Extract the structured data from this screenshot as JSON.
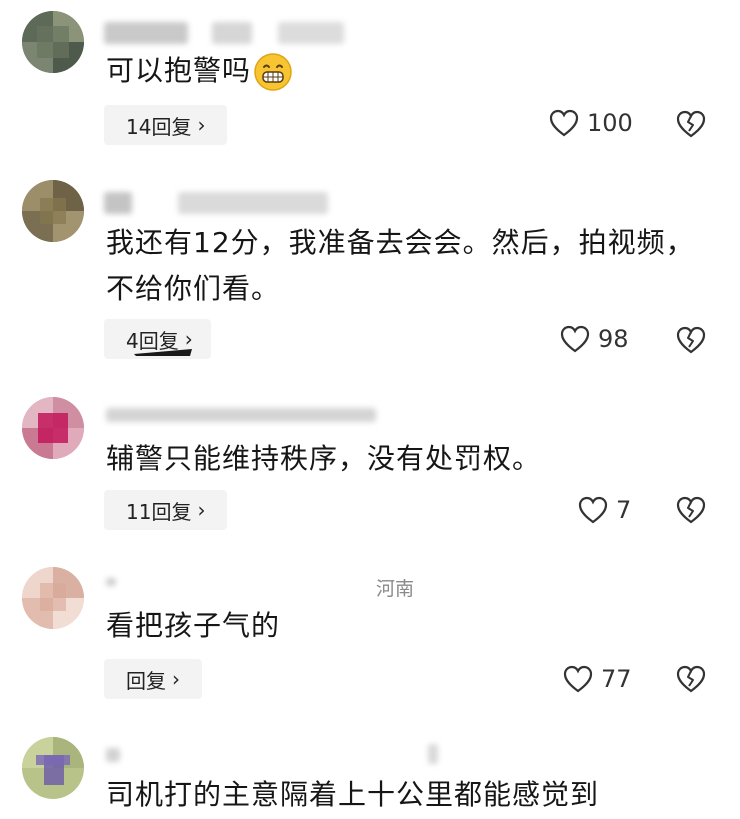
{
  "comments": [
    {
      "text": "可以抱警吗",
      "emoji": "grinning-face-emoji",
      "reply_label": "14回复",
      "likes": "100",
      "location": ""
    },
    {
      "text_line1": "我还有12分，我准备去会会。然后，拍视频，",
      "text_line2": "不给你们看。",
      "reply_label": "4回复",
      "likes": "98",
      "location": ""
    },
    {
      "text": "辅警只能维持秩序，没有处罚权。",
      "reply_label": "11回复",
      "likes": "7",
      "location": ""
    },
    {
      "text": "看把孩子气的",
      "reply_label": "回复",
      "likes": "77",
      "location": "河南"
    },
    {
      "text": "司机打的主意隔着上十公里都能感觉到",
      "location": ""
    }
  ],
  "colors": {
    "text": "#161616",
    "reply_bg": "#f3f3f3",
    "meta": "#8a8a8a"
  },
  "icons": {
    "like": "heart-outline-icon",
    "dislike": "broken-heart-icon",
    "chevron": "chevron-right-icon"
  }
}
